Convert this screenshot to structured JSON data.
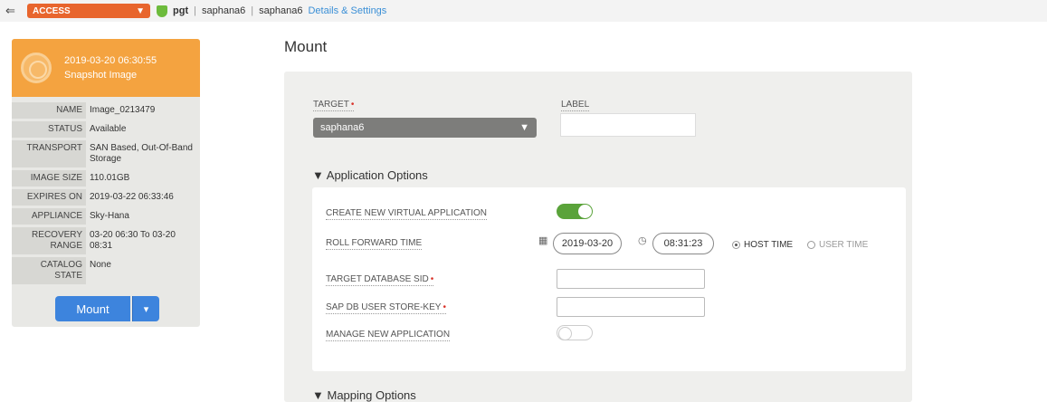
{
  "topbar": {
    "back_icon": "back-arrow-icon",
    "access_label": "ACCESS",
    "status_icon": "shield-check-icon",
    "host": "pgt",
    "app1": "saphana6",
    "app2": "saphana6",
    "details_link": "Details & Settings",
    "separator": "|"
  },
  "card": {
    "timestamp": "2019-03-20 06:30:55",
    "subtitle": "Snapshot Image",
    "props": [
      {
        "k": "NAME",
        "v": "Image_0213479"
      },
      {
        "k": "STATUS",
        "v": "Available"
      },
      {
        "k": "TRANSPORT",
        "v": "SAN Based, Out-Of-Band Storage"
      },
      {
        "k": "IMAGE SIZE",
        "v": "110.01GB"
      },
      {
        "k": "EXPIRES ON",
        "v": "2019-03-22 06:33:46"
      },
      {
        "k": "APPLIANCE",
        "v": "Sky-Hana"
      },
      {
        "k": "RECOVERY RANGE",
        "v": "03-20 06:30 To 03-20 08:31"
      },
      {
        "k": "CATALOG STATE",
        "v": "None"
      }
    ],
    "mount_label": "Mount"
  },
  "main": {
    "title": "Mount",
    "target_label": "TARGET",
    "target_value": "saphana6",
    "label_label": "LABEL",
    "label_value": "",
    "app_options_title": "Application Options",
    "create_vapp_label": "CREATE NEW VIRTUAL APPLICATION",
    "create_vapp_on": true,
    "roll_forward_label": "ROLL FORWARD TIME",
    "roll_date": "2019-03-20",
    "roll_time": "08:31:23",
    "host_time_label": "HOST TIME",
    "user_time_label": "USER TIME",
    "selected_time_mode": "HOST TIME",
    "target_sid_label": "TARGET DATABASE SID",
    "target_sid_value": "",
    "store_key_label": "SAP DB USER STORE-KEY",
    "store_key_value": "",
    "manage_app_label": "MANAGE NEW APPLICATION",
    "manage_app_on": false,
    "mapping_title": "Mapping Options"
  },
  "colors": {
    "access_orange": "#e8652d",
    "card_header": "#f4a340",
    "mount_blue": "#3d84dd",
    "toggle_green": "#5aa33a",
    "link_blue": "#3a8fd6"
  }
}
